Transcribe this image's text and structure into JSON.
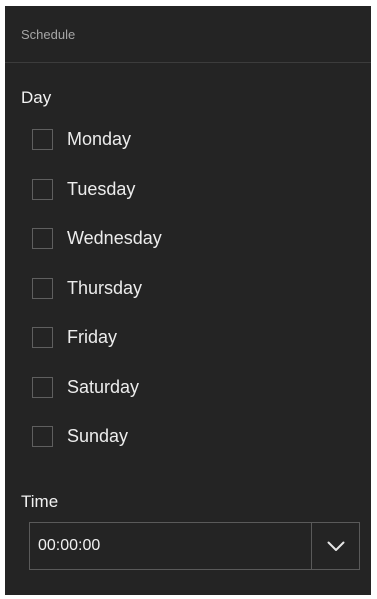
{
  "panel": {
    "title": "Schedule"
  },
  "day_section": {
    "label": "Day",
    "days": [
      {
        "label": "Monday",
        "checked": false
      },
      {
        "label": "Tuesday",
        "checked": false
      },
      {
        "label": "Wednesday",
        "checked": false
      },
      {
        "label": "Thursday",
        "checked": false
      },
      {
        "label": "Friday",
        "checked": false
      },
      {
        "label": "Saturday",
        "checked": false
      },
      {
        "label": "Sunday",
        "checked": false
      }
    ]
  },
  "time_section": {
    "label": "Time",
    "value": "00:00:00",
    "dropdown_icon": "chevron-down-icon"
  },
  "colors": {
    "panel_background": "#242424",
    "text": "#ececec",
    "muted_text": "#a6a6a6",
    "border": "#5a5a5a"
  }
}
